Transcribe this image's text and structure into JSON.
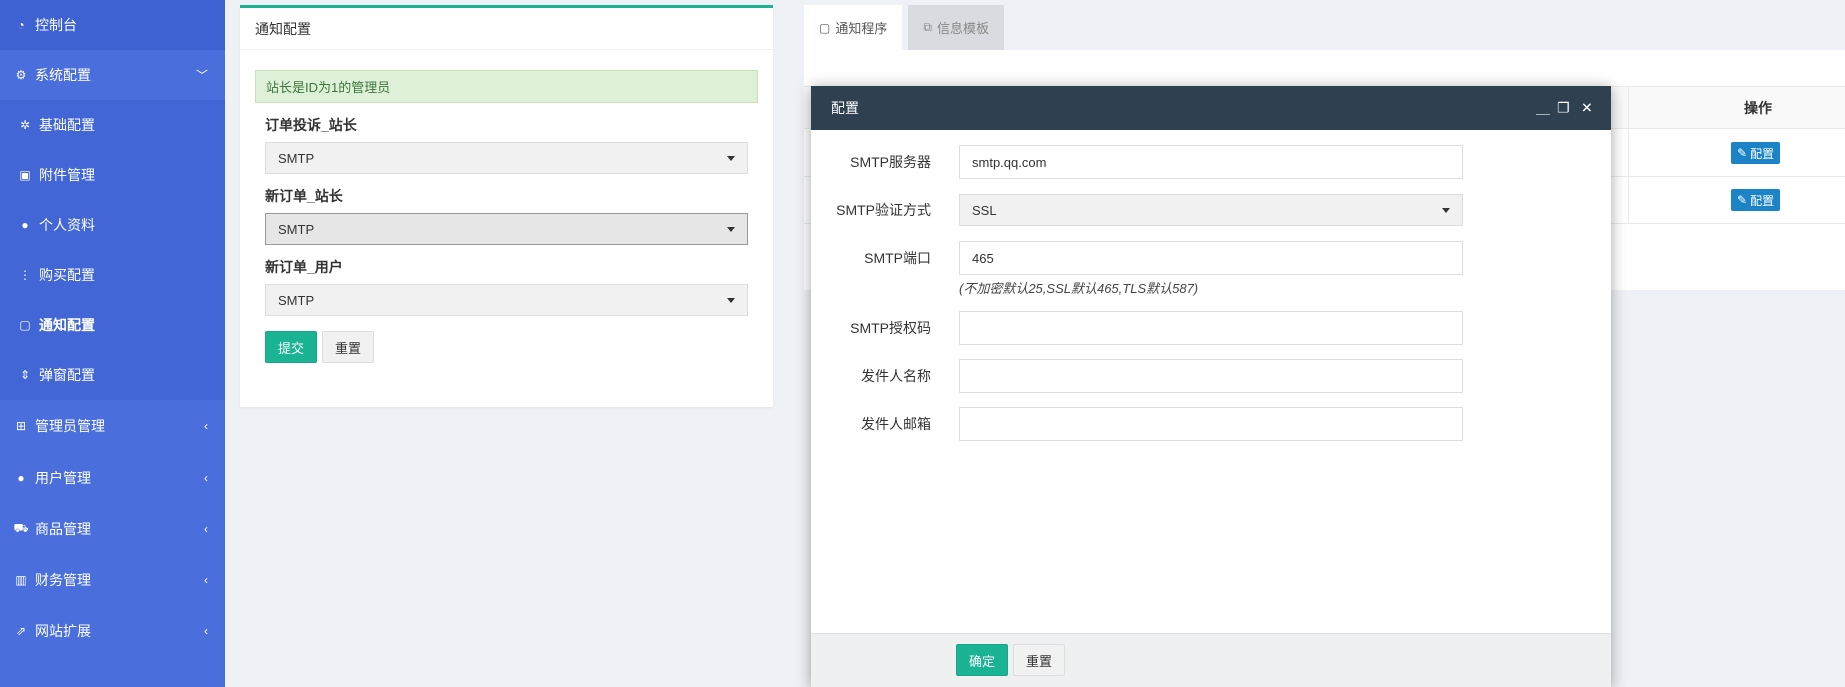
{
  "sidebar": {
    "items": [
      {
        "label": "控制台",
        "icon": "dashboard-icon"
      },
      {
        "label": "系统配置",
        "icon": "cogs-icon"
      },
      {
        "label": "基础配置",
        "icon": "gear-icon"
      },
      {
        "label": "附件管理",
        "icon": "image-file-icon"
      },
      {
        "label": "个人资料",
        "icon": "user-icon"
      },
      {
        "label": "购买配置",
        "icon": "vertical-dots-icon"
      },
      {
        "label": "通知配置",
        "icon": "twitch-icon"
      },
      {
        "label": "弹窗配置",
        "icon": "sort-icon"
      },
      {
        "label": "管理员管理",
        "icon": "windows-icon"
      },
      {
        "label": "用户管理",
        "icon": "user-icon"
      },
      {
        "label": "商品管理",
        "icon": "cart-icon"
      },
      {
        "label": "财务管理",
        "icon": "trello-icon"
      },
      {
        "label": "网站扩展",
        "icon": "external-link-icon"
      }
    ]
  },
  "panel": {
    "title": "通知配置",
    "alert": "站长是ID为1的管理员",
    "fields": [
      {
        "label": "订单投诉_站长",
        "value": "SMTP"
      },
      {
        "label": "新订单_站长",
        "value": "SMTP"
      },
      {
        "label": "新订单_用户",
        "value": "SMTP"
      }
    ],
    "submit_label": "提交",
    "reset_label": "重置"
  },
  "tabs": [
    {
      "label": "通知程序",
      "icon": "twitch-icon"
    },
    {
      "label": "信息模板",
      "icon": "copy-icon"
    }
  ],
  "table": {
    "op_header": "操作",
    "row_button_label": "配置"
  },
  "modal": {
    "title": "配置",
    "fields": [
      {
        "label": "SMTP服务器",
        "value": "smtp.qq.com"
      },
      {
        "label": "SMTP验证方式",
        "value": "SSL"
      },
      {
        "label": "SMTP端口",
        "value": "465"
      },
      {
        "label": "SMTP授权码",
        "value": ""
      },
      {
        "label": "发件人名称",
        "value": ""
      },
      {
        "label": "发件人邮箱",
        "value": ""
      }
    ],
    "port_hint": "(不加密默认25,SSL默认465,TLS默认587)",
    "confirm_label": "确定",
    "reset_label": "重置"
  }
}
